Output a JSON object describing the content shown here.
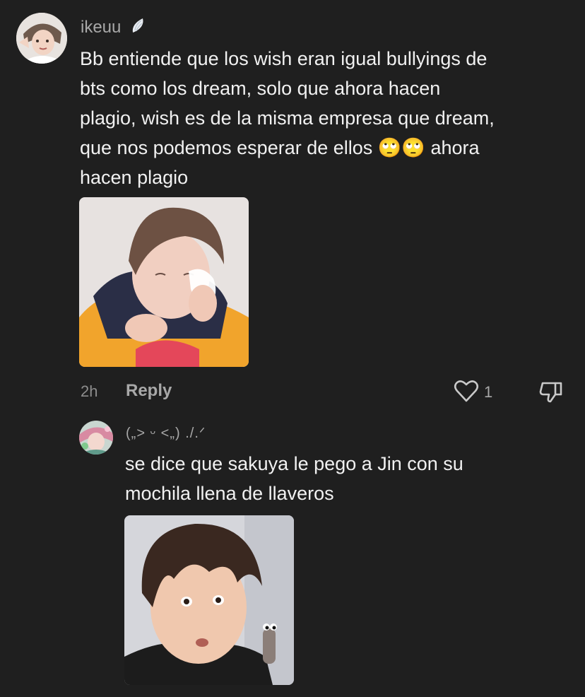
{
  "comments": [
    {
      "username": "ikeuu",
      "username_icon": "wing-emoji-icon",
      "text": "Bb entiende que los wish eran igual bullyings de\nbts como los dream, solo que ahora hacen\nplagio, wish es de la misma empresa que dream,\nque nos podemos esperar de ellos 🙄🙄 ahora\nhacen plagio",
      "image_alt": "photo of person wiping eyes with tissue",
      "time": "2h",
      "reply_label": "Reply",
      "like_count": "1"
    },
    {
      "username": "(„> ᵕ <„) ./.ᐟ",
      "text": "se dice que sakuya le pego a Jin con su\nmochila llena de llaveros",
      "image_alt": "photo of surprised person"
    }
  ],
  "colors": {
    "background": "#1f1f1f",
    "text": "#f1f1f1",
    "muted": "#a8a8a8"
  }
}
